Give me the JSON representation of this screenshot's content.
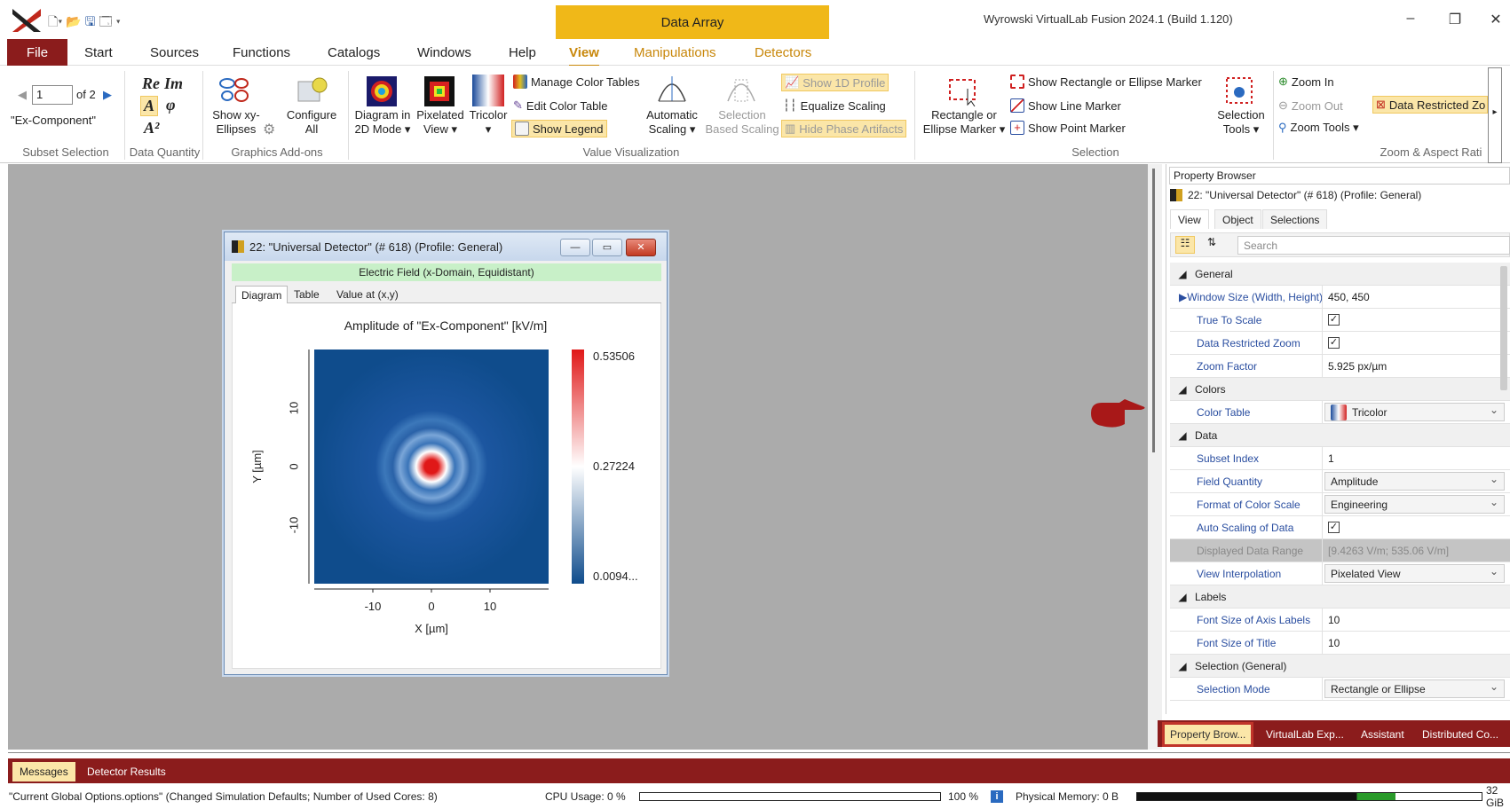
{
  "titlebar": {
    "context_tab": "Data Array",
    "app_title": "Wyrowski VirtualLab Fusion 2024.1 (Build 1.120)",
    "minimize": "–",
    "restore": "❐",
    "close": "✕"
  },
  "menu": {
    "file": "File",
    "start": "Start",
    "sources": "Sources",
    "functions": "Functions",
    "catalogs": "Catalogs",
    "windows": "Windows",
    "help": "Help",
    "view": "View",
    "manipulations": "Manipulations",
    "detectors": "Detectors"
  },
  "ribbon": {
    "subset": {
      "value": "1",
      "of": "of 2",
      "component": "\"Ex-Component\"",
      "group": "Subset Selection"
    },
    "data_quantity": {
      "re": "Re",
      "im": "Im",
      "a": "A",
      "phi": "φ",
      "a2": "A²",
      "group": "Data Quantity"
    },
    "graphics": {
      "show_xy_1": "Show xy-",
      "show_xy_2": "Ellipses",
      "configure_1": "Configure",
      "configure_2": "All",
      "group": "Graphics Add-ons"
    },
    "value_vis": {
      "diagram_1": "Diagram in",
      "diagram_2": "2D Mode ▾",
      "pixelated_1": "Pixelated",
      "pixelated_2": "View ▾",
      "tricolor_1": "Tricolor",
      "tricolor_2": "▾",
      "manage": "Manage Color Tables",
      "edit": "Edit Color Table",
      "legend": "Show Legend",
      "auto_1": "Automatic",
      "auto_2": "Scaling ▾",
      "sel_1": "Selection",
      "sel_2": "Based Scaling",
      "profile": "Show 1D Profile",
      "equalize": "Equalize Scaling",
      "hide": "Hide Phase Artifacts",
      "group": "Value Visualization"
    },
    "selection": {
      "rect_1": "Rectangle or",
      "rect_2": "Ellipse Marker ▾",
      "show_rect": "Show Rectangle or Ellipse Marker",
      "show_line": "Show Line Marker",
      "show_point": "Show Point Marker",
      "tools_1": "Selection",
      "tools_2": "Tools ▾",
      "group": "Selection"
    },
    "zoom": {
      "in": "Zoom In",
      "out": "Zoom Out",
      "tools": "Zoom Tools ▾",
      "restricted": "Data Restricted Zo",
      "group": "Zoom & Aspect Rati"
    }
  },
  "doc": {
    "title": "22: \"Universal Detector\" (# 618) (Profile: General)",
    "subtitle": "Electric Field (x-Domain, Equidistant)",
    "tabs": [
      "Diagram",
      "Table",
      "Value at (x,y)"
    ],
    "buttons": {
      "min": "—",
      "max": "▭",
      "close": "✕"
    }
  },
  "chart_data": {
    "type": "heatmap",
    "title": "Amplitude of \"Ex-Component\"  [kV/m]",
    "xlabel": "X [µm]",
    "ylabel": "Y [µm]",
    "xticks": [
      "-10",
      "0",
      "10"
    ],
    "yticks": [
      "10",
      "0",
      "-10"
    ],
    "colorbar": {
      "max": "0.53506",
      "mid": "0.27224",
      "min": "0.0094..."
    },
    "colormap": "Tricolor",
    "colors": {
      "low": "#0f4c8c",
      "mid": "#ffffff",
      "high": "#e01818"
    }
  },
  "propbrowser": {
    "title": "Property Browser",
    "object": "22: \"Universal Detector\" (# 618) (Profile: General)",
    "tabs": [
      "View",
      "Object",
      "Selections"
    ],
    "search": "Search",
    "cat_general": "General",
    "cat_colors": "Colors",
    "cat_data": "Data",
    "cat_labels": "Labels",
    "cat_selection": "Selection (General)",
    "rows": [
      {
        "k": "Window Size (Width, Height)",
        "v": "450, 450"
      },
      {
        "k": "True To Scale",
        "v": "✓"
      },
      {
        "k": "Data Restricted Zoom",
        "v": "✓"
      },
      {
        "k": "Zoom Factor",
        "v": "5.925 px/µm"
      },
      {
        "k": "Color Table",
        "v": "Tricolor"
      },
      {
        "k": "Subset Index",
        "v": "1"
      },
      {
        "k": "Field Quantity",
        "v": "Amplitude"
      },
      {
        "k": "Format of Color Scale",
        "v": "Engineering"
      },
      {
        "k": "Auto Scaling of Data",
        "v": "✓"
      },
      {
        "k": "Displayed Data Range",
        "v": "[9.4263 V/m; 535.06 V/m]"
      },
      {
        "k": "View Interpolation",
        "v": "Pixelated View"
      },
      {
        "k": "Font Size of Axis Labels",
        "v": "10"
      },
      {
        "k": "Font Size of Title",
        "v": "10"
      },
      {
        "k": "Selection Mode",
        "v": "Rectangle or Ellipse"
      }
    ]
  },
  "bottom_tabs": [
    "Property Brow...",
    "VirtualLab Exp...",
    "Assistant",
    "Distributed Co..."
  ],
  "messages": {
    "header": "Messages",
    "tabs": [
      "Messages",
      "Detector Results"
    ]
  },
  "status": {
    "options": "\"Current Global Options.options\" (Changed Simulation Defaults; Number of Used Cores: 8)",
    "cpu": "CPU Usage:  0 %",
    "cpu_end": "100 %",
    "mem": "Physical Memory:  0 B",
    "mem_end": "32 GiB",
    "cpu_level": 0.0,
    "mem_level": 0.75
  }
}
